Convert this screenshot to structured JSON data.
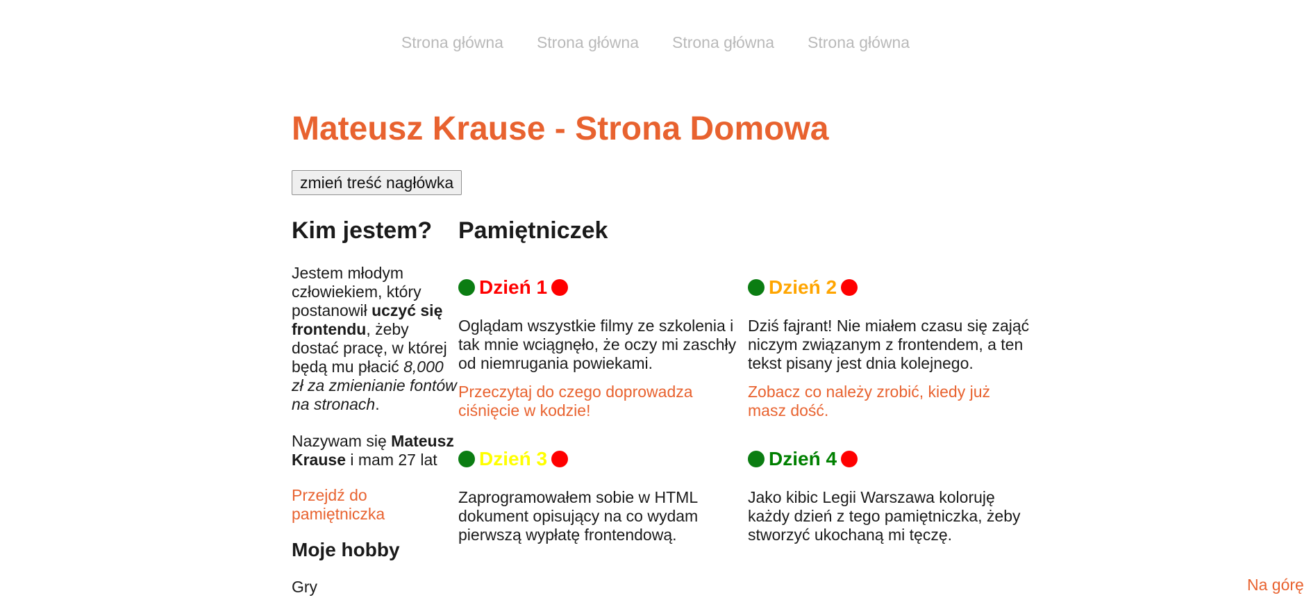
{
  "nav": {
    "items": [
      {
        "label": "Strona główna"
      },
      {
        "label": "Strona główna"
      },
      {
        "label": "Strona główna"
      },
      {
        "label": "Strona główna"
      }
    ]
  },
  "header": {
    "title": "Mateusz Krause - Strona Domowa",
    "change_button": "zmień treść nagłówka"
  },
  "about": {
    "heading": "Kim jestem?",
    "intro_1": "Jestem młodym człowiekiem, który postanowił ",
    "intro_bold": "uczyć się frontendu",
    "intro_2": ", żeby dostać pracę, w której będą mu płacić ",
    "intro_italic": "8,000 zł za zmienianie fontów na stronach",
    "intro_3": ".",
    "name_1": "Nazywam się ",
    "name_bold": "Mateusz Krause",
    "name_2": " i mam 27 lat",
    "diary_link": "Przejdź do pamiętniczka",
    "hobby_heading": "Moje hobby",
    "hobby_first": "Gry"
  },
  "diary": {
    "heading": "Pamiętniczek",
    "entries": [
      {
        "title": "Dzień 1",
        "title_color": "#ff0000",
        "text": "Oglądam wszystkie filmy ze szkolenia i tak mnie wciągnęło, że oczy mi zaschły od niemrugania powiekami.",
        "link": "Przeczytaj do czego doprowadza ciśnięcie w kodzie!"
      },
      {
        "title": "Dzień 2",
        "title_color": "#ffa500",
        "text": "Dziś fajrant! Nie miałem czasu się zająć niczym związanym z frontendem, a ten tekst pisany jest dnia kolejnego.",
        "link": "Zobacz co należy zrobić, kiedy już masz dość."
      },
      {
        "title": "Dzień 3",
        "title_color": "#ffff00",
        "text": "Zaprogramowałem sobie w HTML dokument opisujący na co wydam pierwszą wypłatę frontendową.",
        "link": ""
      },
      {
        "title": "Dzień 4",
        "title_color": "#008000",
        "text": "Jako kibic Legii Warszawa koloruję każdy dzień z tego pamiętniczka, żeby stworzyć ukochaną mi tęczę.",
        "link": ""
      }
    ]
  },
  "footer": {
    "to_top": "Na górę"
  },
  "colors": {
    "accent": "#e8622f",
    "nav_text": "#b9b9b9",
    "dot_green": "#0b7d12",
    "dot_red": "#ff0000"
  }
}
